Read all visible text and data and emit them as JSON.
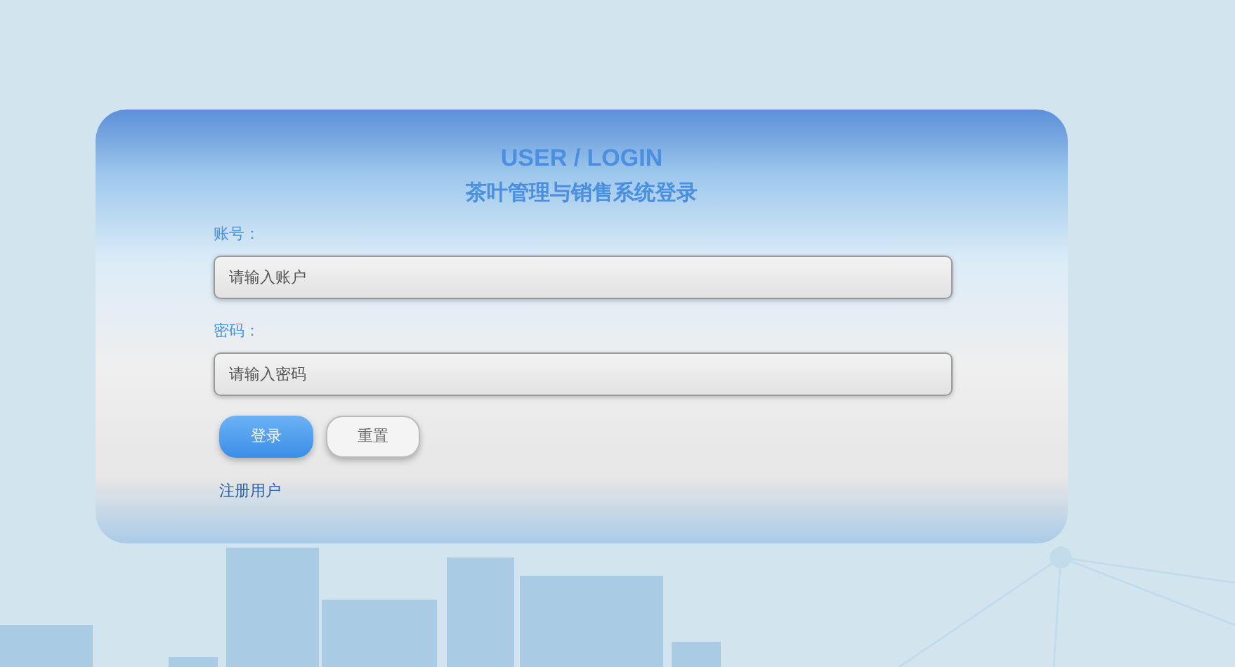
{
  "login_card": {
    "title": "USER / LOGIN",
    "subtitle": "茶叶管理与销售系统登录",
    "fields": [
      {
        "label": "账号：",
        "placeholder": "请输入账户"
      },
      {
        "label": "密码：",
        "placeholder": "请输入密码"
      }
    ],
    "buttons": [
      {
        "label": "登录",
        "kind": "primary"
      },
      {
        "label": "重置",
        "kind": "secondary"
      }
    ],
    "register_link": "注册用户"
  }
}
